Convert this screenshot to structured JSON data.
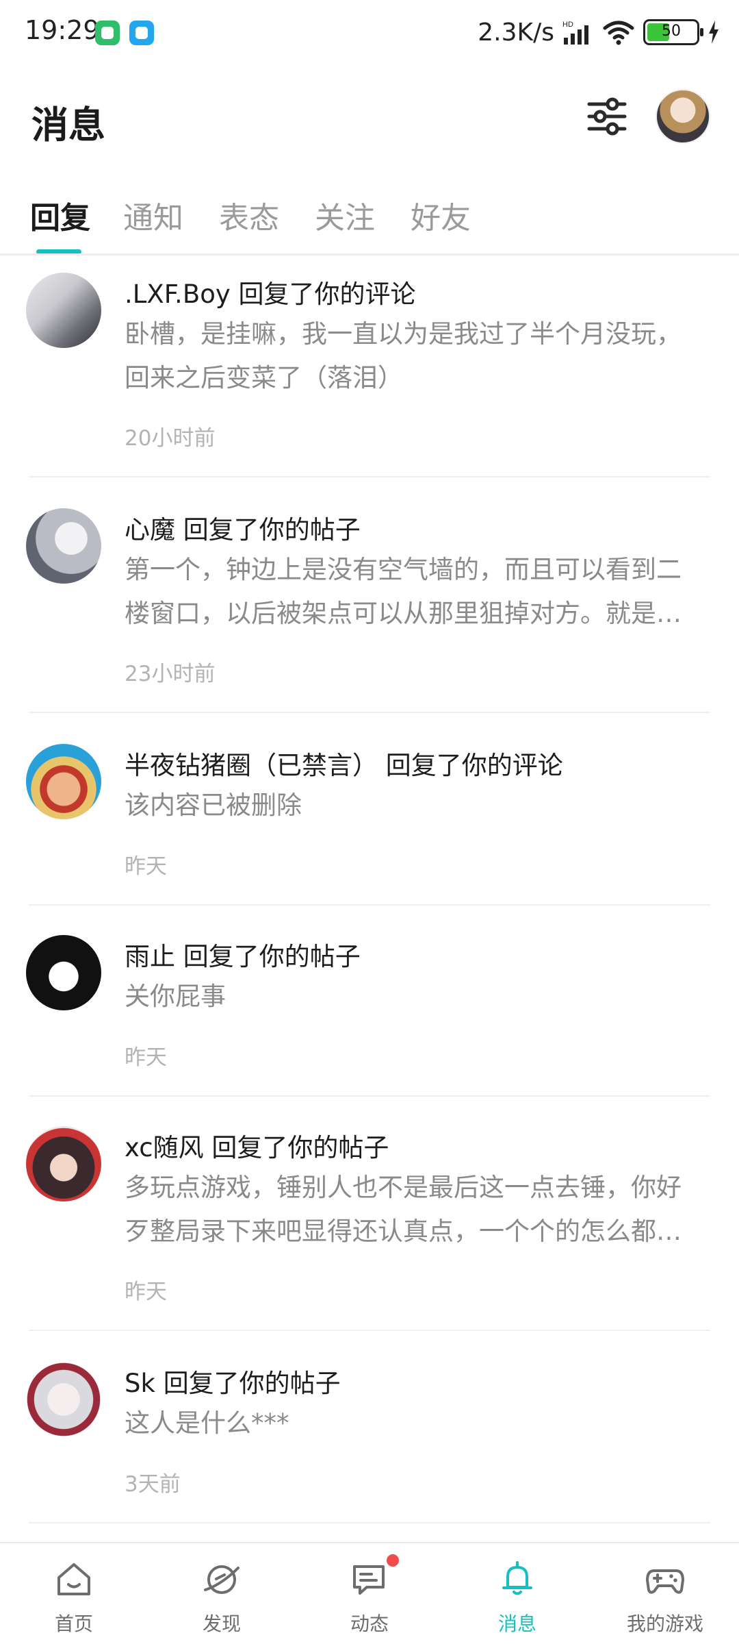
{
  "status_bar": {
    "time": "19:29",
    "network_speed": "2.3K/s",
    "battery": "50",
    "battery_level": 0.5
  },
  "header": {
    "title": "消息"
  },
  "tabs": [
    {
      "label": "回复",
      "active": true
    },
    {
      "label": "通知",
      "active": false
    },
    {
      "label": "表态",
      "active": false
    },
    {
      "label": "关注",
      "active": false
    },
    {
      "label": "好友",
      "active": false
    }
  ],
  "messages": [
    {
      "user": ".LXF.Boy",
      "action": "回复了你的评论",
      "content": "卧槽，是挂嘛，我一直以为是我过了半个月没玩，回来之后变菜了（落泪）",
      "time": "20小时前"
    },
    {
      "user": "心魔",
      "action": "回复了你的帖子",
      "content": "第一个，钟边上是没有空气墙的，而且可以看到二楼窗口，以后被架点可以从那里狙掉对方。就是这里",
      "time": "23小时前"
    },
    {
      "user": "半夜钻猪圈（已禁言）",
      "action": "回复了你的评论",
      "content": "该内容已被删除",
      "time": "昨天"
    },
    {
      "user": "雨止",
      "action": "回复了你的帖子",
      "content": "关你屁事",
      "time": "昨天"
    },
    {
      "user": "xc随风",
      "action": "回复了你的帖子",
      "content": "多玩点游戏，锤别人也不是最后这一点去锤，你好歹整局录下来吧显得还认真点，一个个的怎么都这样",
      "time": "昨天"
    },
    {
      "user": "Sk",
      "action": "回复了你的帖子",
      "content": "这人是什么***",
      "time": "3天前"
    }
  ],
  "bottom_nav": [
    {
      "label": "首页",
      "icon": "home-icon",
      "active": false
    },
    {
      "label": "发现",
      "icon": "discover-icon",
      "active": false
    },
    {
      "label": "动态",
      "icon": "feed-icon",
      "active": false,
      "badge": true
    },
    {
      "label": "消息",
      "icon": "bell-icon",
      "active": true
    },
    {
      "label": "我的游戏",
      "icon": "gamepad-icon",
      "active": false
    }
  ],
  "colors": {
    "accent": "#16bfc1",
    "badge": "#f24a4a"
  }
}
